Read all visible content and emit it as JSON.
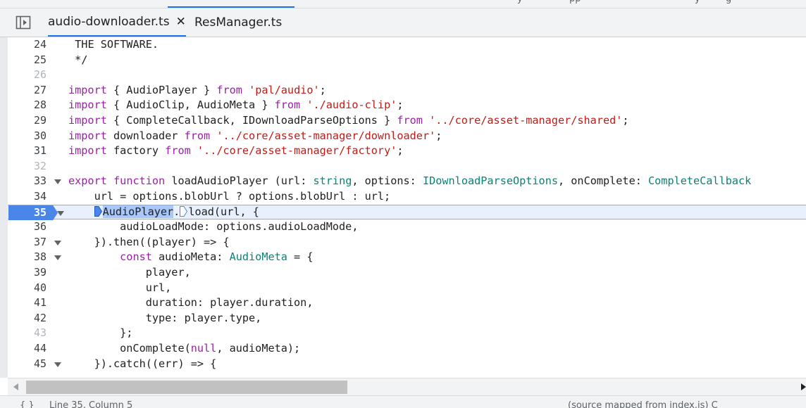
{
  "top_strip": {
    "fragments": [
      "y",
      "pp",
      "y",
      "g"
    ]
  },
  "tabs": [
    {
      "label": "audio-downloader.ts",
      "close": "✕"
    },
    {
      "label": "ResManager.ts"
    }
  ],
  "gutter": {
    "lines": [
      "24",
      "25",
      "26",
      "27",
      "28",
      "29",
      "30",
      "31",
      "32",
      "33",
      "34",
      "35",
      "36",
      "37",
      "38",
      "39",
      "40",
      "41",
      "42",
      "43",
      "44",
      "45"
    ]
  },
  "code": {
    "l24": "THE SOFTWARE.",
    "l25": "*/",
    "l27": {
      "kw": "import",
      "a": " { AudioPlayer } ",
      "kw2": "from",
      "s": "'pal/audio'",
      "end": ";"
    },
    "l28": {
      "kw": "import",
      "a": " { AudioClip, AudioMeta } ",
      "kw2": "from",
      "s": "'./audio-clip'",
      "end": ";"
    },
    "l29": {
      "kw": "import",
      "a": " { CompleteCallback, IDownloadParseOptions } ",
      "kw2": "from",
      "s": "'../core/asset-manager/shared'",
      "end": ";"
    },
    "l30": {
      "kw": "import",
      "a": " downloader ",
      "kw2": "from",
      "s": "'../core/asset-manager/downloader'",
      "end": ";"
    },
    "l31": {
      "kw": "import",
      "a": " factory ",
      "kw2": "from",
      "s": "'../core/asset-manager/factory'",
      "end": ";"
    },
    "l33": {
      "kw": "export",
      "kw2": "function",
      "a": " loadAudioPlayer (url: ",
      "t1": "string",
      "b": ", options: ",
      "t2": "IDownloadParseOptions",
      "c": ", onComplete: ",
      "t3": "CompleteCallback"
    },
    "l34": "    url = options.blobUrl ? options.blobUrl : url;",
    "l35": {
      "pre": "    ",
      "hl": "AudioPlayer",
      "dot": ".",
      "rest": "load(url, {"
    },
    "l36": "        audioLoadMode: options.audioLoadMode,",
    "l37": "    }).then((player) => {",
    "l38": {
      "pre": "        ",
      "kw": "const",
      "a": " audioMeta: ",
      "t": "AudioMeta",
      "b": " = {"
    },
    "l39": "            player,",
    "l40": "            url,",
    "l41": "            duration: player.duration,",
    "l42": "            type: player.type,",
    "l43": "        };",
    "l44": {
      "pre": "        onComplete(",
      "kw": "null",
      "b": ", audioMeta);"
    },
    "l45": "    }).catch((err) => {"
  },
  "status": {
    "left": "{ }",
    "position": "Line 35, Column 5",
    "right": "(source mapped from index.js) C"
  },
  "colors": {
    "accent": "#1a73e8",
    "breakpoint": "#4a86e8",
    "keyword": "#9c1fa8",
    "string": "#c41a16",
    "type": "#0b8276"
  }
}
